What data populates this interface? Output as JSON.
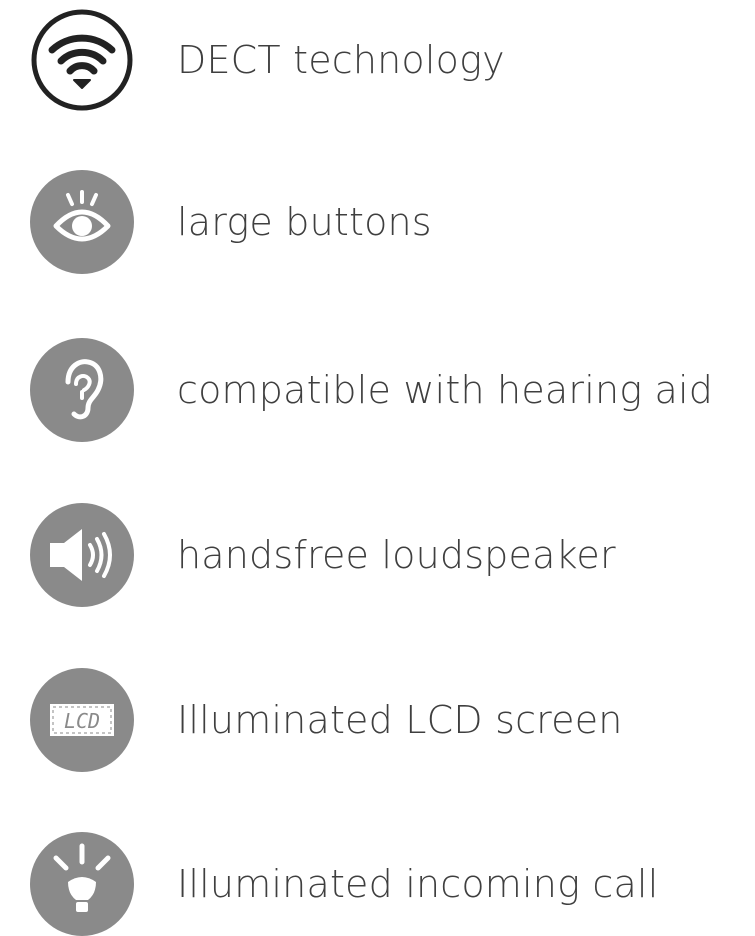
{
  "features": [
    {
      "icon": "wifi-icon",
      "label": "DECT technology"
    },
    {
      "icon": "eye-icon",
      "label": "large buttons"
    },
    {
      "icon": "ear-icon",
      "label": "compatible with hearing aid"
    },
    {
      "icon": "speaker-icon",
      "label": "handsfree loudspeaker"
    },
    {
      "icon": "lcd-screen-icon",
      "label": "Illuminated LCD screen",
      "icon_text": "LCD"
    },
    {
      "icon": "light-bulb-icon",
      "label": "Illuminated incoming call"
    }
  ],
  "colors": {
    "icon_fill": "#8a8a8a",
    "icon_outline": "#222222",
    "text": "#3f3f3f"
  }
}
